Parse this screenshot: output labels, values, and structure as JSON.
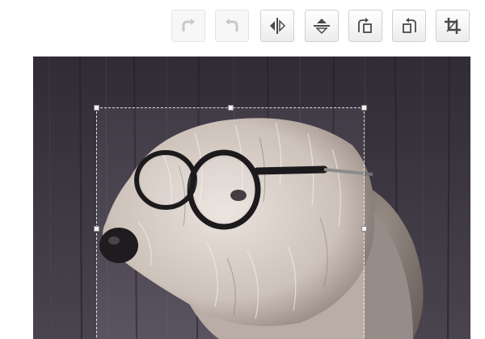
{
  "toolbar": {
    "buttons": [
      {
        "id": "redo",
        "icon": "redo-icon",
        "enabled": false
      },
      {
        "id": "undo",
        "icon": "undo-icon",
        "enabled": false
      },
      {
        "id": "flip-horizontal",
        "icon": "flip-horizontal-icon",
        "enabled": true
      },
      {
        "id": "flip-vertical",
        "icon": "flip-vertical-icon",
        "enabled": true
      },
      {
        "id": "rotate-clockwise",
        "icon": "rotate-clockwise-icon",
        "enabled": true
      },
      {
        "id": "rotate-counterclockwise",
        "icon": "rotate-counterclockwise-icon",
        "enabled": true
      },
      {
        "id": "crop",
        "icon": "crop-icon",
        "enabled": true
      }
    ]
  },
  "editor": {
    "image_subject": "dog-wearing-glasses",
    "crop_active": true
  },
  "colors": {
    "icon_dark": "#4a4a4a",
    "icon_disabled": "#c8c8c8",
    "wood_background": "#4a4450",
    "fur": "#d8cfc8"
  }
}
